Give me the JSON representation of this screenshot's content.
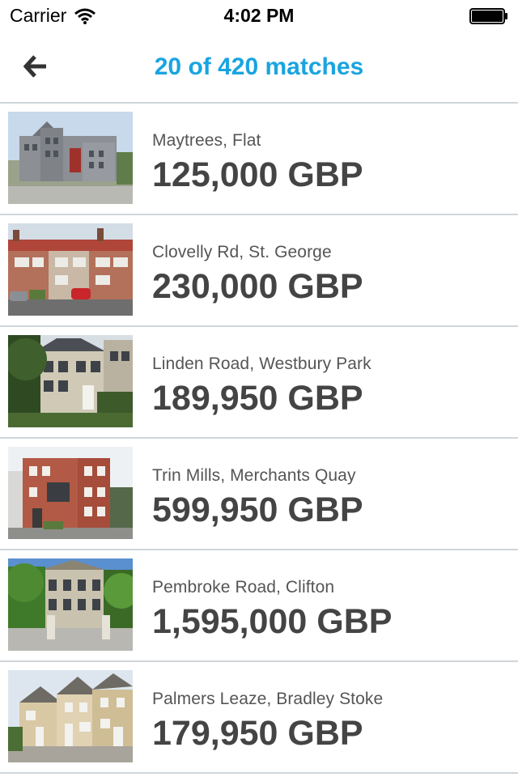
{
  "status_bar": {
    "carrier": "Carrier",
    "time": "4:02 PM"
  },
  "nav": {
    "title": "20 of 420 matches",
    "back_icon": "arrow-left-icon",
    "accent": "#19a4e0"
  },
  "listings": [
    {
      "address": "Maytrees, Flat",
      "price": "125,000 GBP"
    },
    {
      "address": "Clovelly Rd, St. George",
      "price": "230,000 GBP"
    },
    {
      "address": "Linden Road, Westbury Park",
      "price": "189,950 GBP"
    },
    {
      "address": "Trin Mills, Merchants Quay",
      "price": "599,950 GBP"
    },
    {
      "address": "Pembroke Road, Clifton",
      "price": "1,595,000 GBP"
    },
    {
      "address": "Palmers Leaze, Bradley Stoke",
      "price": "179,950 GBP"
    }
  ]
}
